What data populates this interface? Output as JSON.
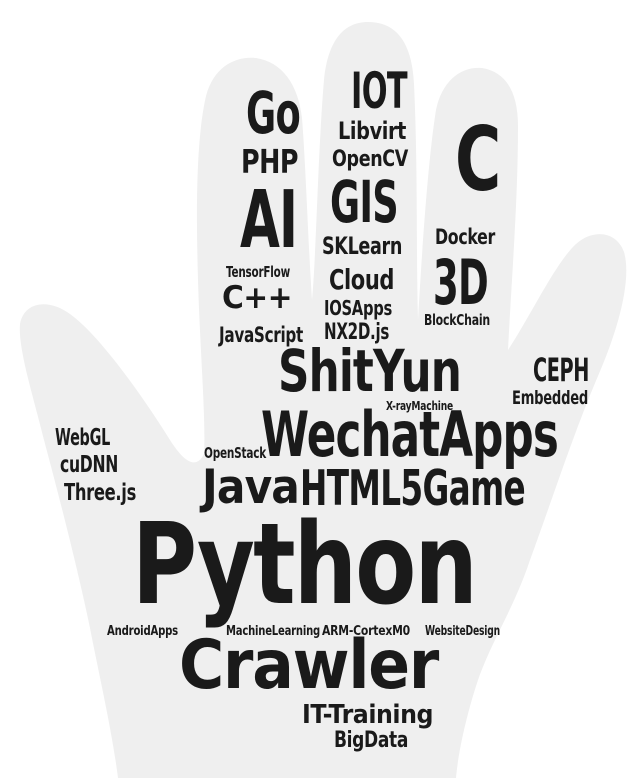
{
  "colors": {
    "background": "#ffffff",
    "hand": "#efefef",
    "text": "#1a1a1a"
  },
  "words": [
    {
      "id": "go",
      "text": "Go"
    },
    {
      "id": "iot",
      "text": "IOT"
    },
    {
      "id": "libvirt",
      "text": "Libvirt"
    },
    {
      "id": "php",
      "text": "PHP"
    },
    {
      "id": "opencv",
      "text": "OpenCV"
    },
    {
      "id": "c",
      "text": "C"
    },
    {
      "id": "ai",
      "text": "AI"
    },
    {
      "id": "gis",
      "text": "GIS"
    },
    {
      "id": "sklearn",
      "text": "SKLearn"
    },
    {
      "id": "docker",
      "text": "Docker"
    },
    {
      "id": "tensorflow",
      "text": "TensorFlow"
    },
    {
      "id": "cloud",
      "text": "Cloud"
    },
    {
      "id": "3d",
      "text": "3D"
    },
    {
      "id": "cpp",
      "text": "C++"
    },
    {
      "id": "iosapps",
      "text": "IOSApps"
    },
    {
      "id": "blockchain",
      "text": "BlockChain"
    },
    {
      "id": "javascript",
      "text": "JavaScript"
    },
    {
      "id": "nx2djs",
      "text": "NX2D.js"
    },
    {
      "id": "shityun",
      "text": "ShitYun"
    },
    {
      "id": "ceph",
      "text": "CEPH"
    },
    {
      "id": "embedded",
      "text": "Embedded"
    },
    {
      "id": "xraymachine",
      "text": "X-rayMachine"
    },
    {
      "id": "webgl",
      "text": "WebGL"
    },
    {
      "id": "wechatapps",
      "text": "WechatApps"
    },
    {
      "id": "cudnn",
      "text": "cuDNN"
    },
    {
      "id": "openstack",
      "text": "OpenStack"
    },
    {
      "id": "java",
      "text": "Java"
    },
    {
      "id": "html5game",
      "text": "HTML5Game"
    },
    {
      "id": "threejs",
      "text": "Three.js"
    },
    {
      "id": "python",
      "text": "Python"
    },
    {
      "id": "androidapps",
      "text": "AndroidApps"
    },
    {
      "id": "machinelearning",
      "text": "MachineLearning"
    },
    {
      "id": "armcortexm0",
      "text": "ARM-CortexM0"
    },
    {
      "id": "websitedesign",
      "text": "WebsiteDesign"
    },
    {
      "id": "crawler",
      "text": "Crawler"
    },
    {
      "id": "ittraining",
      "text": "IT-Training"
    },
    {
      "id": "bigdata",
      "text": "BigData"
    }
  ]
}
